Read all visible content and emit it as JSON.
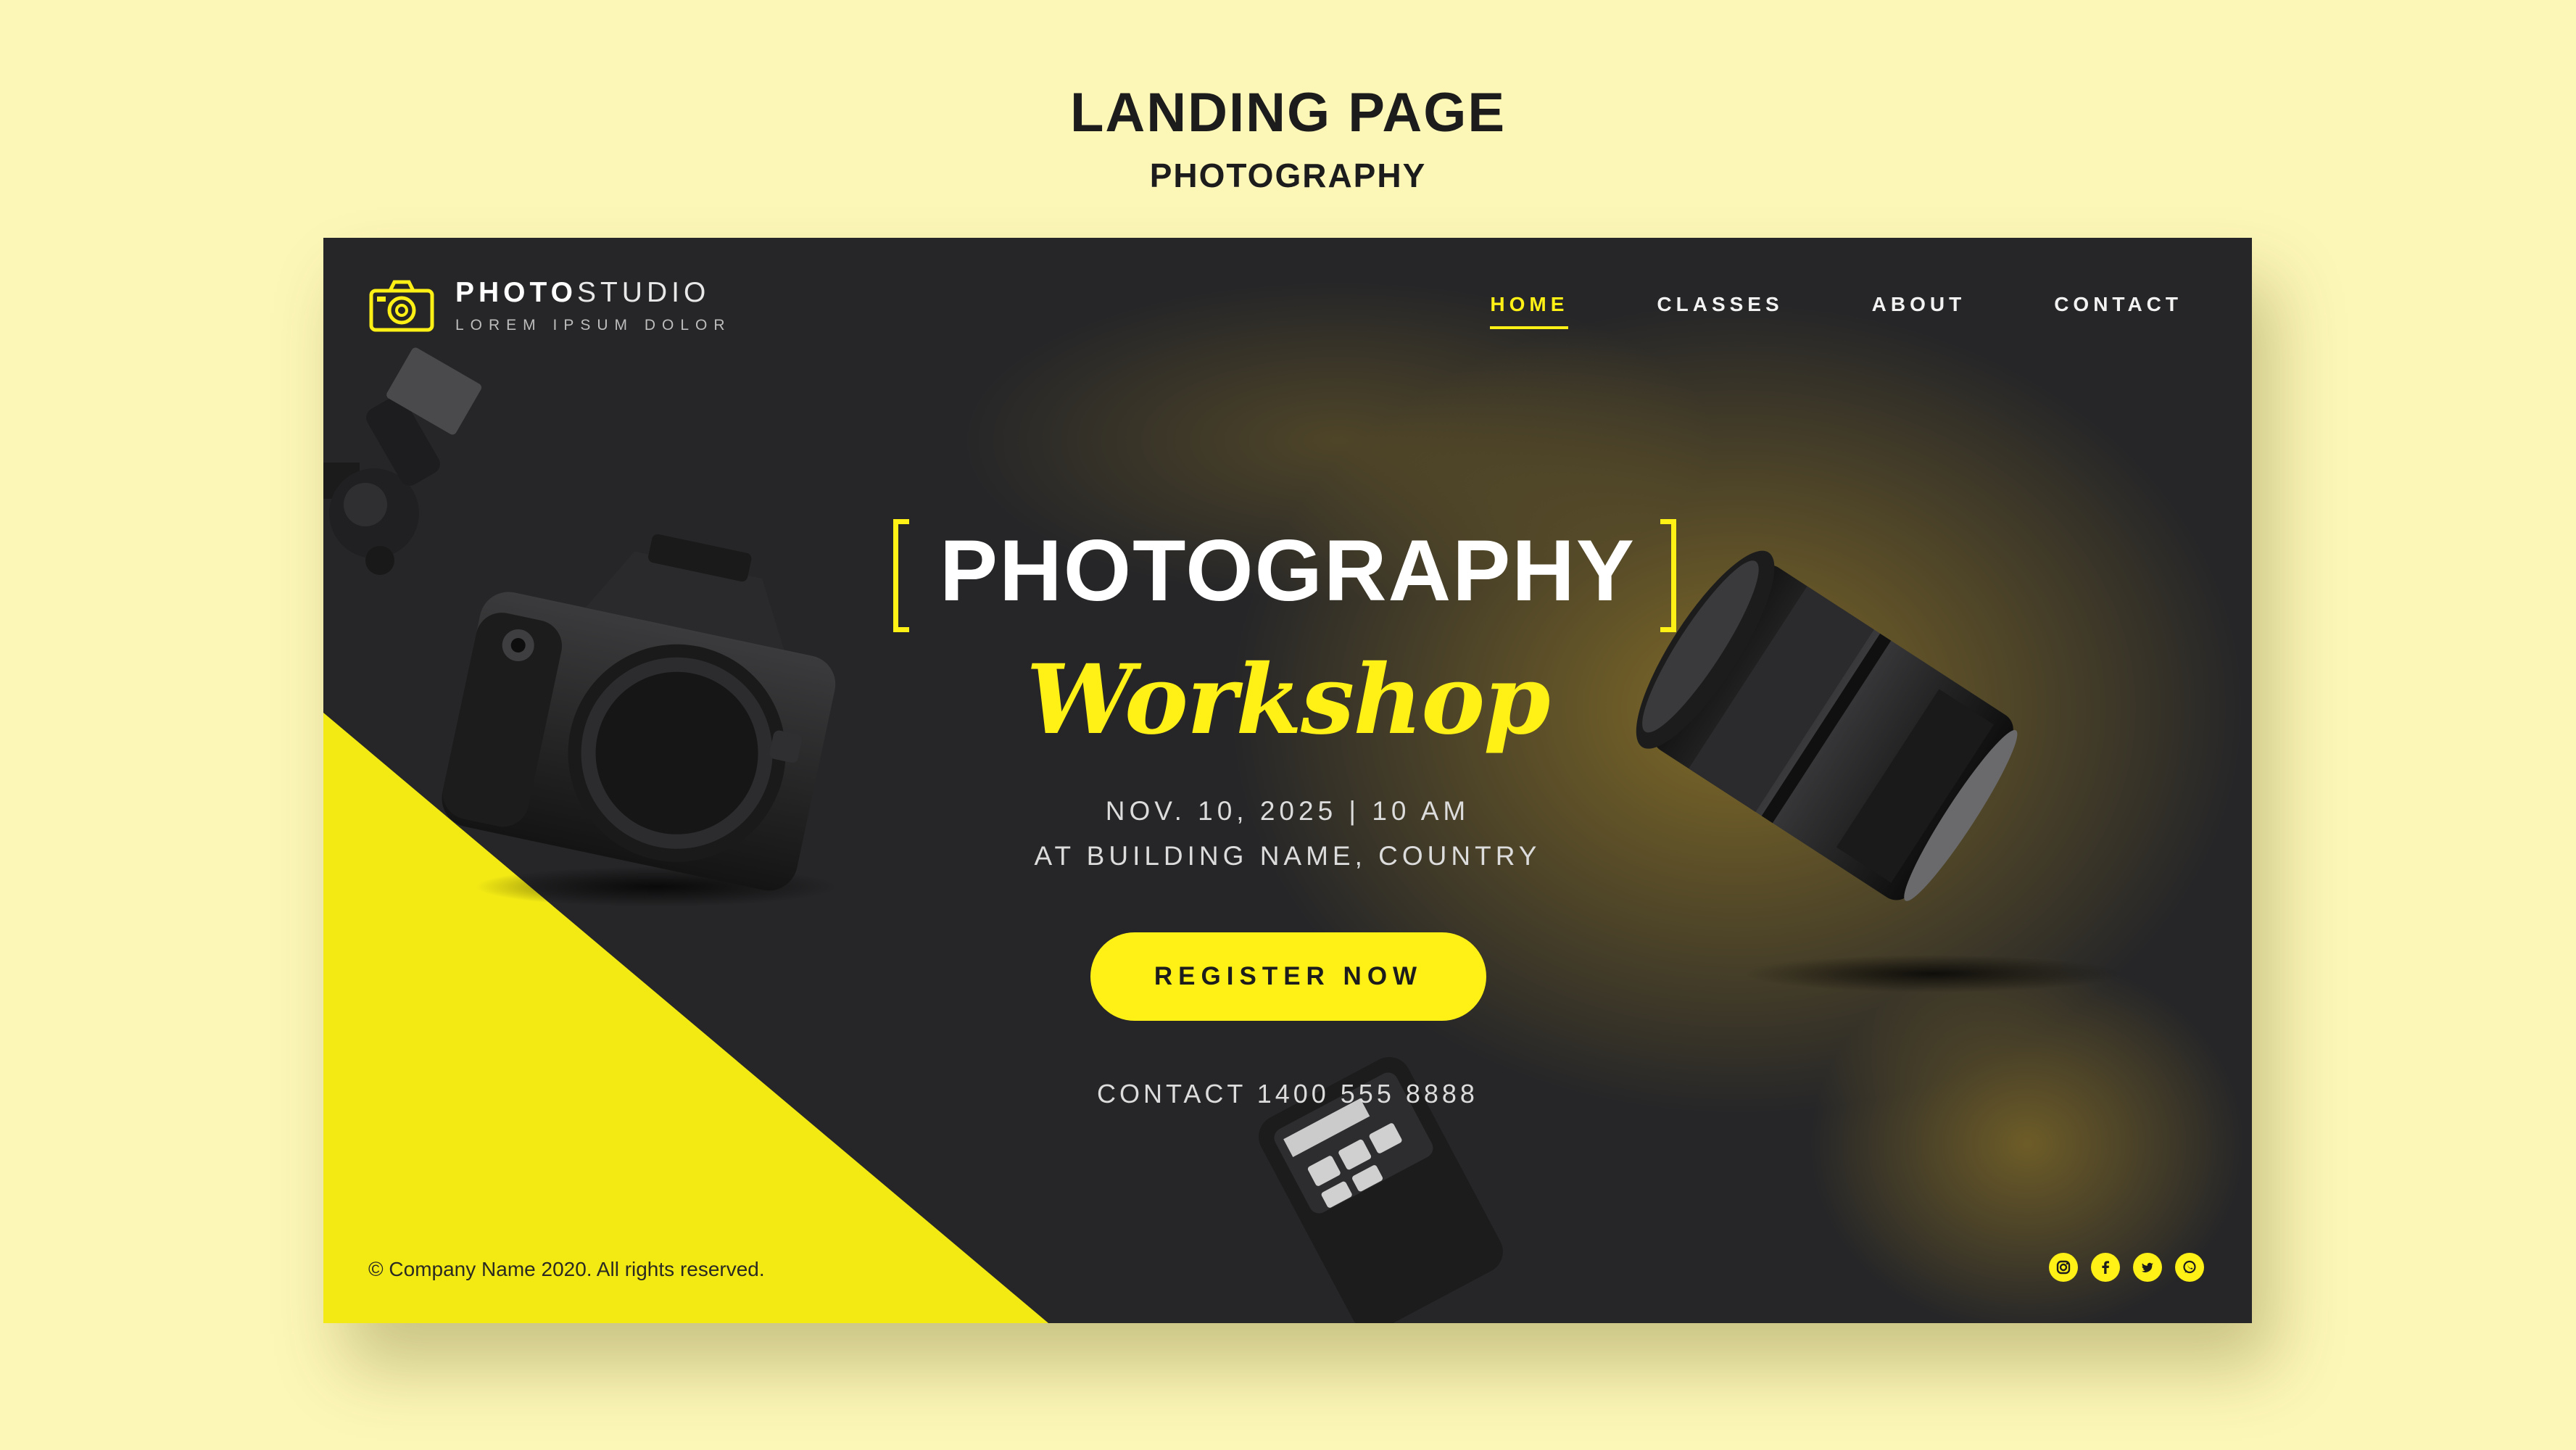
{
  "showcase": {
    "title": "LANDING PAGE",
    "subtitle": "PHOTOGRAPHY"
  },
  "brand": {
    "name_bold": "PHOTO",
    "name_light": "STUDIO",
    "tagline": "LOREM IPSUM DOLOR",
    "icon": "camera-outline-icon"
  },
  "nav": {
    "items": [
      {
        "label": "HOME",
        "active": true
      },
      {
        "label": "CLASSES",
        "active": false
      },
      {
        "label": "ABOUT",
        "active": false
      },
      {
        "label": "CONTACT",
        "active": false
      }
    ]
  },
  "hero": {
    "title": "PHOTOGRAPHY",
    "script": "Workshop",
    "date": "NOV. 10, 2025  |  10 AM",
    "location": "AT BUILDING NAME, COUNTRY",
    "cta": "REGISTER NOW",
    "contact": "CONTACT 1400 555 8888"
  },
  "footer": {
    "copyright": "© Company Name 2020. All rights reserved.",
    "socials": [
      "instagram-icon",
      "facebook-icon",
      "twitter-icon",
      "whatsapp-icon"
    ]
  },
  "colors": {
    "accent": "#fff016",
    "page_background": "#fdf7b7",
    "panel_background": "#262628",
    "text_dark": "#1c1c1c"
  }
}
